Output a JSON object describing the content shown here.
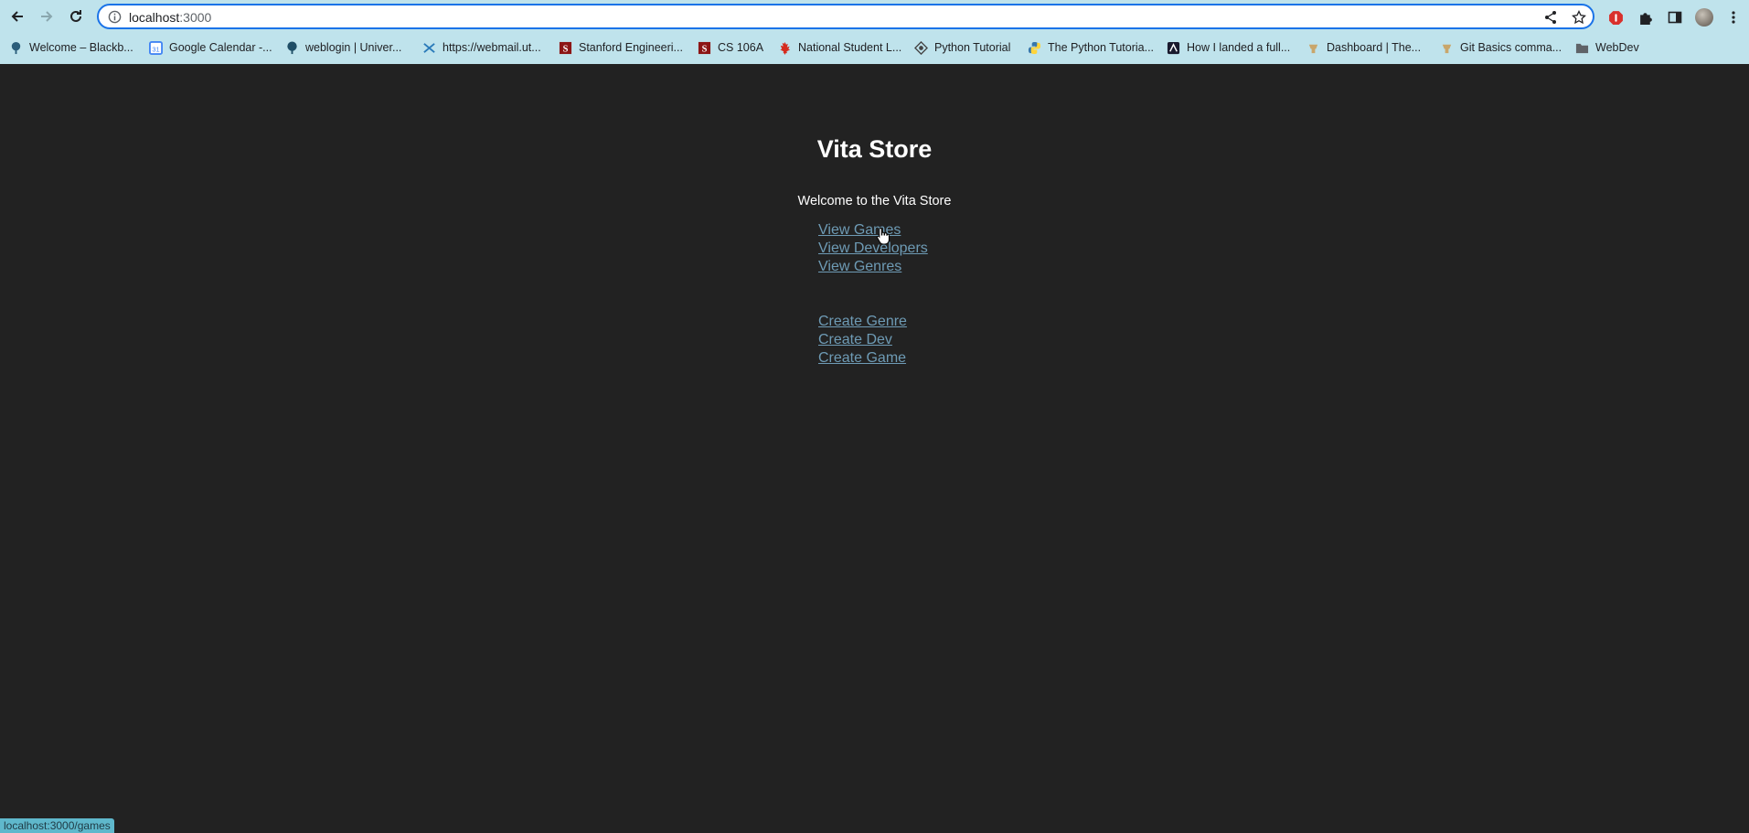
{
  "browser": {
    "url_host": "localhost",
    "url_path": ":3000",
    "bookmarks": [
      {
        "label": "Welcome – Blackb...",
        "icon": "blackboard-icon"
      },
      {
        "label": "Google Calendar -...",
        "icon": "calendar-icon"
      },
      {
        "label": "weblogin | Univer...",
        "icon": "tree-icon"
      },
      {
        "label": "https://webmail.ut...",
        "icon": "webmail-icon"
      },
      {
        "label": "Stanford Engineeri...",
        "icon": "stanford-icon"
      },
      {
        "label": "CS 106A",
        "icon": "stanford-icon"
      },
      {
        "label": "National Student L...",
        "icon": "maple-leaf-icon"
      },
      {
        "label": "Python Tutorial",
        "icon": "python-tutorial-icon"
      },
      {
        "label": "The Python Tutoria...",
        "icon": "python-icon"
      },
      {
        "label": "How I landed a full...",
        "icon": "article-icon"
      },
      {
        "label": "Dashboard | The...",
        "icon": "odin-icon"
      },
      {
        "label": "Git Basics comma...",
        "icon": "odin-icon"
      },
      {
        "label": "WebDev",
        "icon": "folder-icon"
      }
    ],
    "status_url": "localhost:3000/games"
  },
  "page": {
    "title": "Vita Store",
    "welcome": "Welcome to the Vita Store",
    "view_links": [
      "View Games",
      "View Developers",
      "View Genres"
    ],
    "create_links": [
      "Create Genre",
      "Create Dev",
      "Create Game"
    ]
  },
  "colors": {
    "background": "#222222",
    "link": "#6e9bb5",
    "chrome": "#bfe3ec",
    "omnibox_border": "#1a73e8"
  }
}
